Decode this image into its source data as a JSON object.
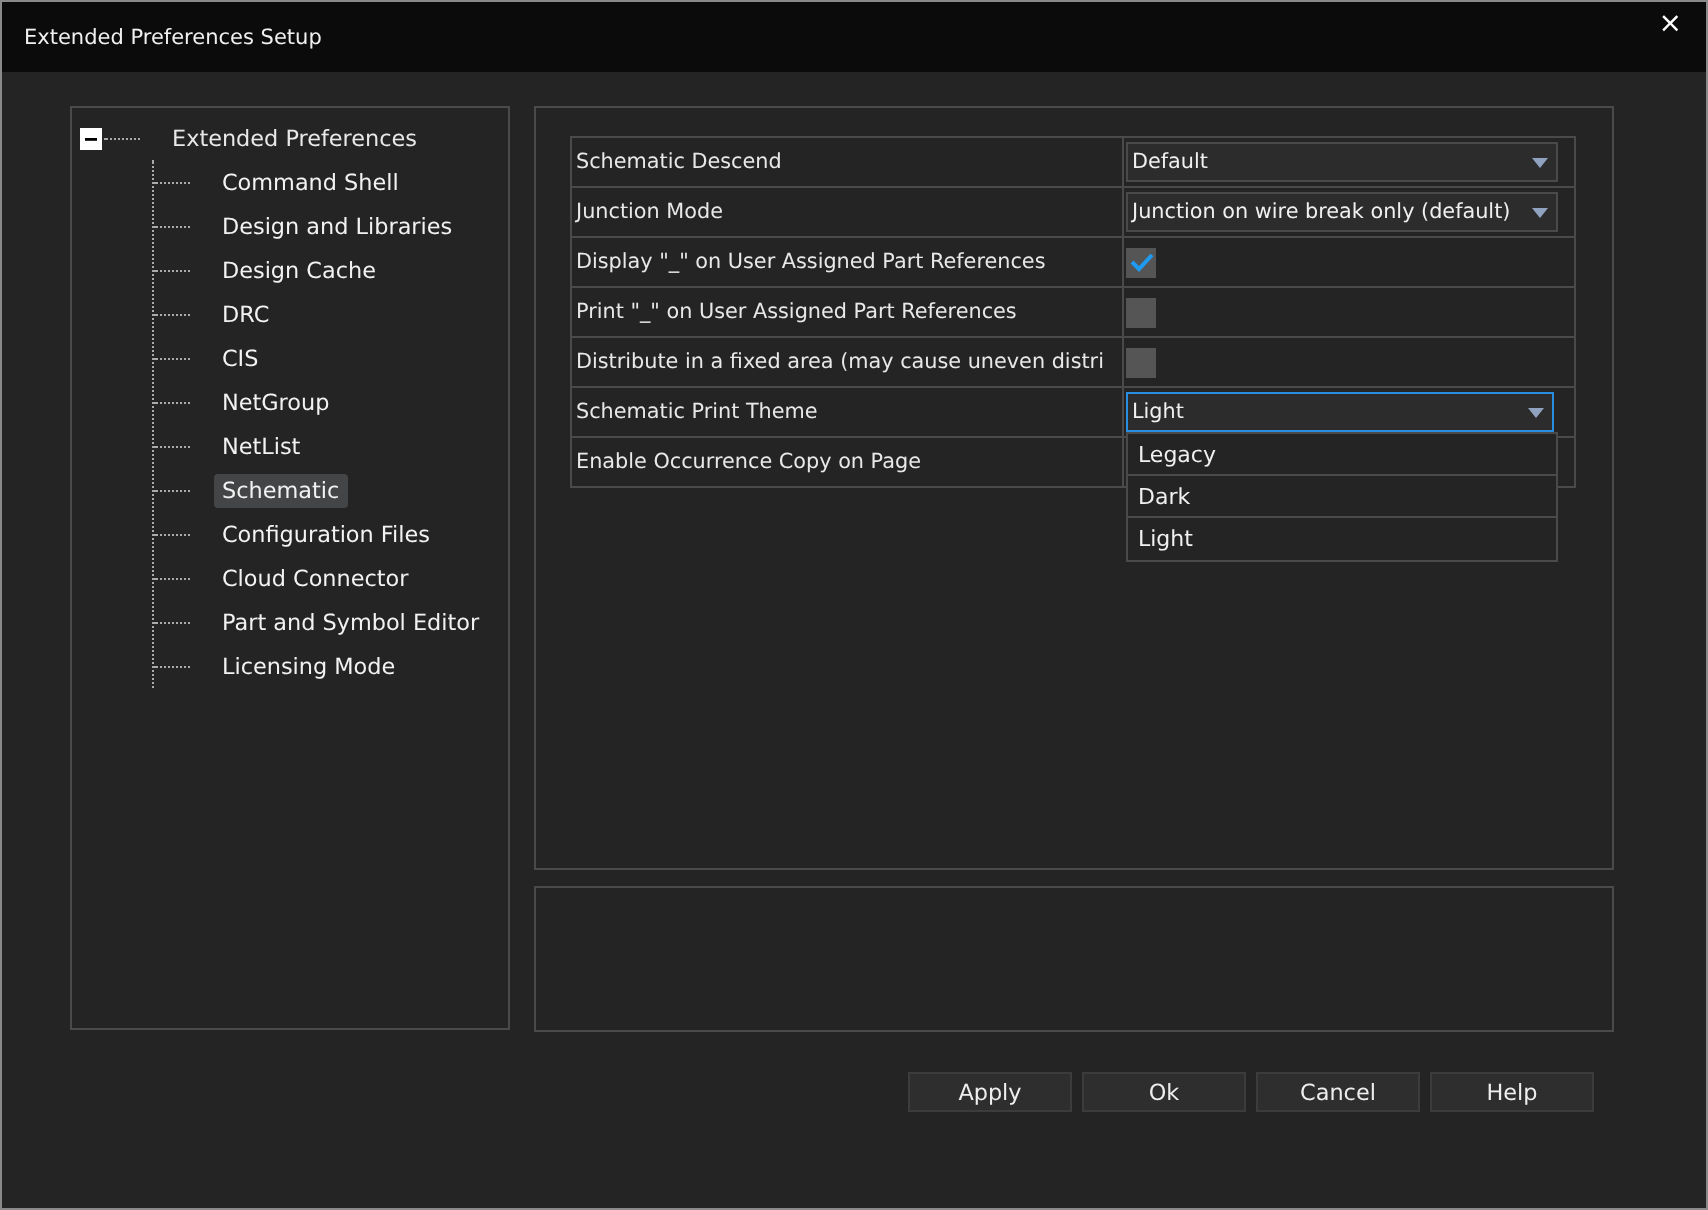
{
  "window": {
    "title": "Extended Preferences Setup",
    "close": "×"
  },
  "tree": {
    "label": "Extended Preferences",
    "expanded": true,
    "children": [
      {
        "label": "Command Shell",
        "selected": false
      },
      {
        "label": "Design and Libraries",
        "selected": false
      },
      {
        "label": "Design Cache",
        "selected": false
      },
      {
        "label": "DRC",
        "selected": false
      },
      {
        "label": "CIS",
        "selected": false
      },
      {
        "label": "NetGroup",
        "selected": false
      },
      {
        "label": "NetList",
        "selected": false
      },
      {
        "label": "Schematic",
        "selected": true
      },
      {
        "label": "Configuration Files",
        "selected": false
      },
      {
        "label": "Cloud Connector",
        "selected": false
      },
      {
        "label": "Part and Symbol Editor",
        "selected": false
      },
      {
        "label": "Licensing Mode",
        "selected": false
      }
    ]
  },
  "properties": [
    {
      "name": "Schematic Descend",
      "kind": "dropdown",
      "value": "Default",
      "open": false
    },
    {
      "name": "Junction Mode",
      "kind": "dropdown",
      "value": "Junction on wire break only (default)",
      "open": false
    },
    {
      "name": "Display \"_\" on User Assigned Part References",
      "kind": "checkbox",
      "checked": true
    },
    {
      "name": "Print \"_\" on User Assigned Part References",
      "kind": "checkbox",
      "checked": false
    },
    {
      "name": "Distribute in a fixed area (may cause uneven distri",
      "kind": "checkbox",
      "checked": false
    },
    {
      "name": "Schematic Print Theme",
      "kind": "dropdown",
      "value": "Light",
      "open": true,
      "options": [
        "Legacy",
        "Dark",
        "Light"
      ]
    },
    {
      "name": "Enable Occurrence Copy on Page",
      "kind": "hidden"
    }
  ],
  "buttons": [
    "Apply",
    "Ok",
    "Cancel",
    "Help"
  ]
}
